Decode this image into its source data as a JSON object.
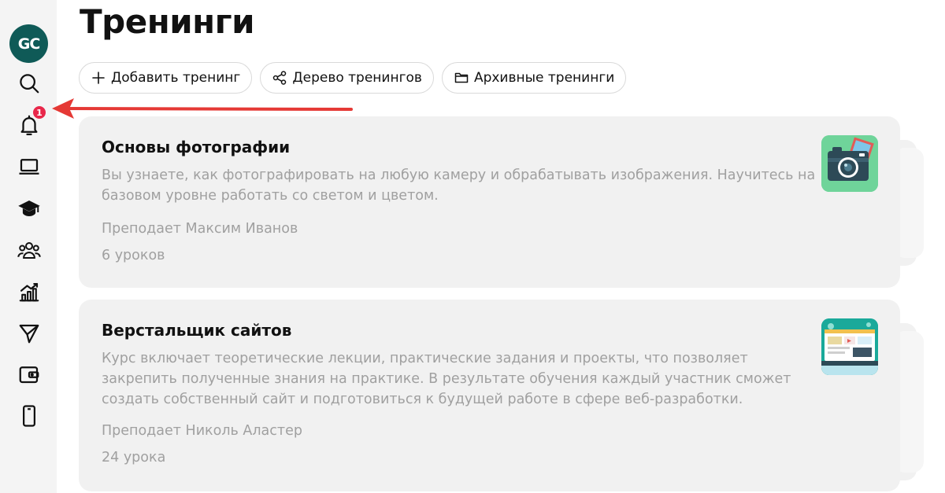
{
  "sidebar": {
    "logo_text": "GC",
    "notification_count": "1",
    "icons": [
      "search-icon",
      "bell-icon",
      "laptop-icon",
      "graduation-cap-icon",
      "users-icon",
      "chart-icon",
      "send-icon",
      "wallet-icon",
      "phone-icon"
    ]
  },
  "page": {
    "title": "Тренинги"
  },
  "toolbar": {
    "add_label": "Добавить тренинг",
    "tree_label": "Дерево тренингов",
    "archive_label": "Архивные тренинги"
  },
  "trainings": [
    {
      "title": "Основы фотографии",
      "description": "Вы узнаете, как фотографировать на любую камеру и обрабатывать изображения. Научитесь на базовом уровне работать со светом и цветом.",
      "teacher": "Преподает Максим Иванов",
      "lessons": "6 уроков",
      "thumb_icon": "camera-icon"
    },
    {
      "title": "Верстальщик сайтов",
      "description": "Курс включает теоретические лекции, практические задания и проекты, что позволяет закрепить полученные знания на практике. В результате обучения каждый участник сможет создать собственный сайт и подготовиться к будущей работе в сфере веб-разработки.",
      "teacher": "Преподает Николь Аластер",
      "lessons": "24 урока",
      "thumb_icon": "web-layout-icon"
    }
  ],
  "colors": {
    "logo_bg": "#0f5a57",
    "badge": "#e8274a",
    "arrow": "#e53935",
    "card_bg": "#f1f1f1",
    "muted_text": "#a0a0a0"
  }
}
